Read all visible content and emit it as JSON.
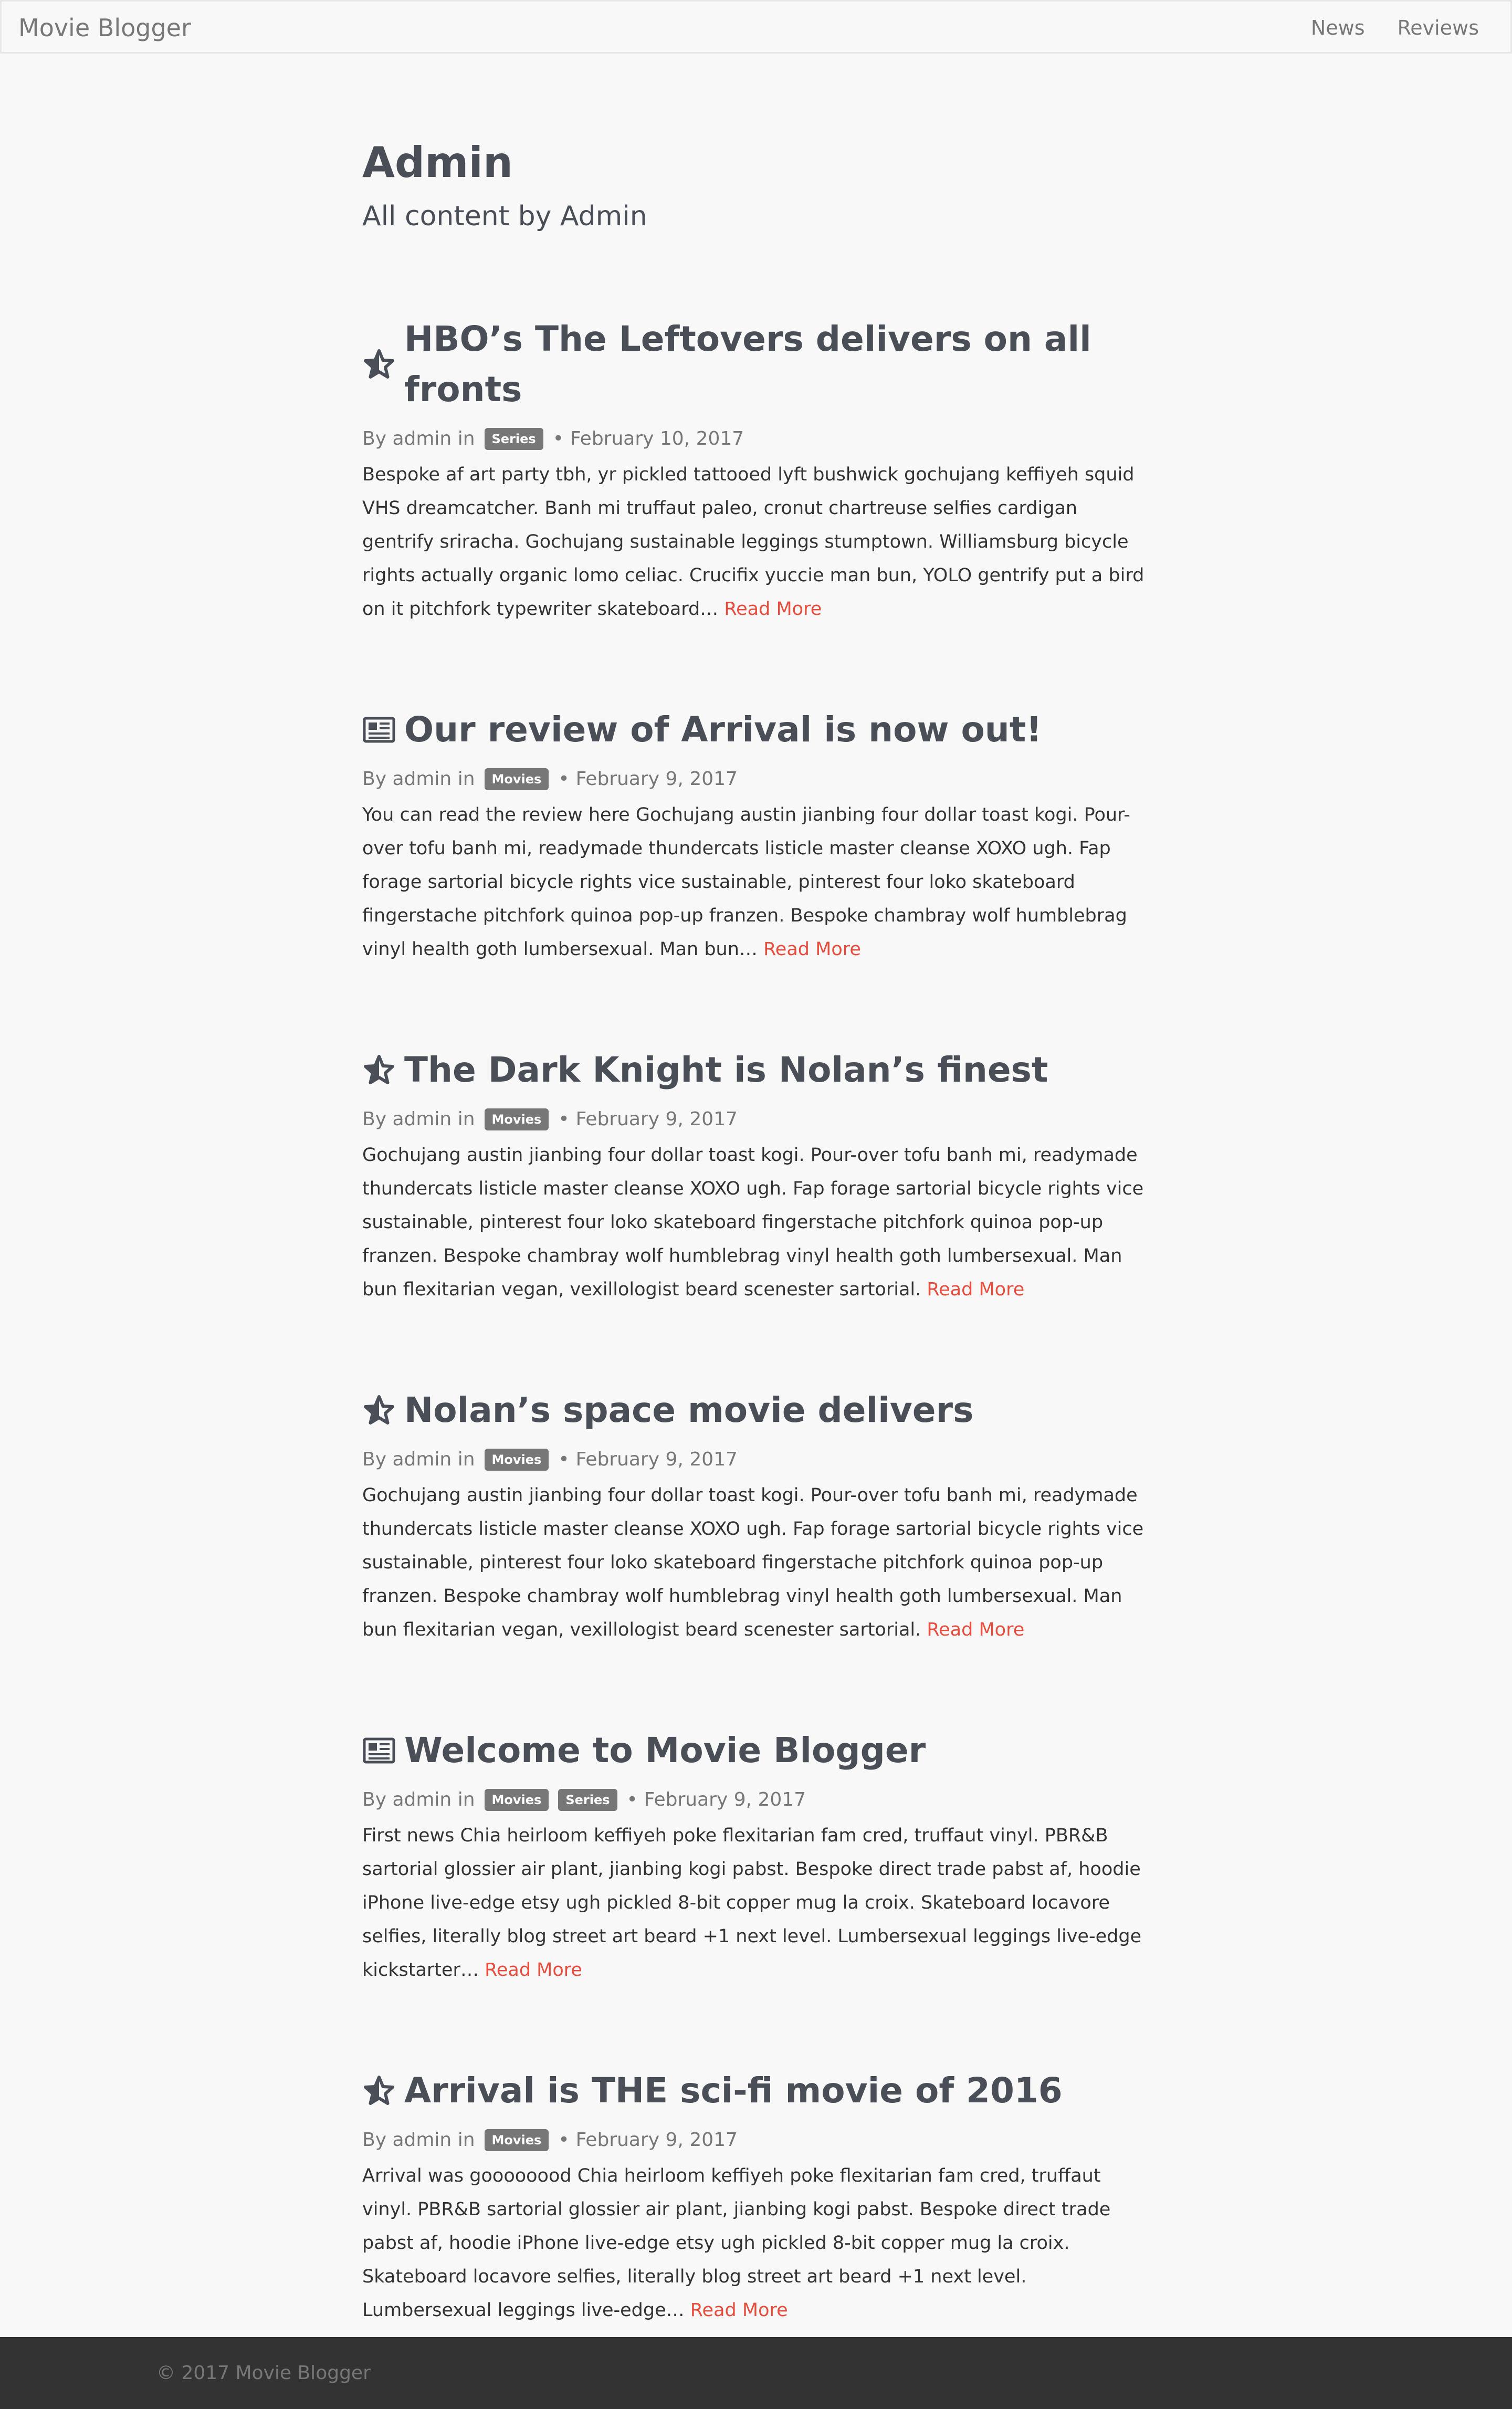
{
  "navbar": {
    "brand": "Movie Blogger",
    "links": [
      "News",
      "Reviews"
    ]
  },
  "page": {
    "title": "Admin",
    "subtitle": "All content by Admin"
  },
  "posts": [
    {
      "icon": "star-icon",
      "title": "HBO’s The Leftovers delivers on all fronts",
      "by": "By admin in",
      "tags": [
        "Series"
      ],
      "date": "February 10, 2017",
      "excerpt": "Bespoke af art party tbh, yr pickled tattooed lyft bushwick gochujang keffiyeh squid VHS dreamcatcher. Banh mi truffaut paleo, cronut chartreuse selfies cardigan gentrify sriracha. Gochujang sustainable leggings stumptown. Williamsburg bicycle rights actually organic lomo celiac. Crucifix yuccie man bun, YOLO gentrify put a bird on it pitchfork typewriter skateboard…",
      "read_more": "Read More"
    },
    {
      "icon": "newspaper-icon",
      "title": "Our review of Arrival is now out!",
      "by": "By admin in",
      "tags": [
        "Movies"
      ],
      "date": "February 9, 2017",
      "excerpt": "You can read the review here Gochujang austin jianbing four dollar toast kogi. Pour-over tofu banh mi, readymade thundercats listicle master cleanse XOXO ugh. Fap forage sartorial bicycle rights vice sustainable, pinterest four loko skateboard fingerstache pitchfork quinoa pop-up franzen. Bespoke chambray wolf humblebrag vinyl health goth lumbersexual. Man bun…",
      "read_more": "Read More"
    },
    {
      "icon": "star-icon",
      "title": "The Dark Knight is Nolan’s finest",
      "by": "By admin in",
      "tags": [
        "Movies"
      ],
      "date": "February 9, 2017",
      "excerpt": "Gochujang austin jianbing four dollar toast kogi. Pour-over tofu banh mi, readymade thundercats listicle master cleanse XOXO ugh. Fap forage sartorial bicycle rights vice sustainable, pinterest four loko skateboard fingerstache pitchfork quinoa pop-up franzen. Bespoke chambray wolf humblebrag vinyl health goth lumbersexual. Man bun flexitarian vegan, vexillologist beard scenester sartorial.",
      "read_more": "Read More"
    },
    {
      "icon": "star-icon",
      "title": "Nolan’s space movie delivers",
      "by": "By admin in",
      "tags": [
        "Movies"
      ],
      "date": "February 9, 2017",
      "excerpt": "Gochujang austin jianbing four dollar toast kogi. Pour-over tofu banh mi, readymade thundercats listicle master cleanse XOXO ugh. Fap forage sartorial bicycle rights vice sustainable, pinterest four loko skateboard fingerstache pitchfork quinoa pop-up franzen. Bespoke chambray wolf humblebrag vinyl health goth lumbersexual. Man bun flexitarian vegan, vexillologist beard scenester sartorial.",
      "read_more": "Read More"
    },
    {
      "icon": "newspaper-icon",
      "title": "Welcome to Movie Blogger",
      "by": "By admin in",
      "tags": [
        "Movies",
        "Series"
      ],
      "date": "February 9, 2017",
      "excerpt": "First news Chia heirloom keffiyeh poke flexitarian fam cred, truffaut vinyl. PBR&B sartorial glossier air plant, jianbing kogi pabst. Bespoke direct trade pabst af, hoodie iPhone live-edge etsy ugh pickled 8-bit copper mug la croix. Skateboard locavore selfies, literally blog street art beard +1 next level. Lumbersexual leggings live-edge kickstarter…",
      "read_more": "Read More"
    },
    {
      "icon": "star-icon",
      "title": "Arrival is THE sci-fi movie of 2016",
      "by": "By admin in",
      "tags": [
        "Movies"
      ],
      "date": "February 9, 2017",
      "excerpt": "Arrival was goooooood Chia heirloom keffiyeh poke flexitarian fam cred, truffaut vinyl. PBR&B sartorial glossier air plant, jianbing kogi pabst. Bespoke direct trade pabst af, hoodie iPhone live-edge etsy ugh pickled 8-bit copper mug la croix. Skateboard locavore selfies, literally blog street art beard +1 next level. Lumbersexual leggings live-edge…",
      "read_more": "Read More"
    }
  ],
  "footer": {
    "text": "© 2017 Movie Blogger"
  },
  "colors": {
    "accent": "#e74c3c",
    "badge": "#777777",
    "heading": "#4a4e57",
    "footer_bg": "#333333"
  }
}
